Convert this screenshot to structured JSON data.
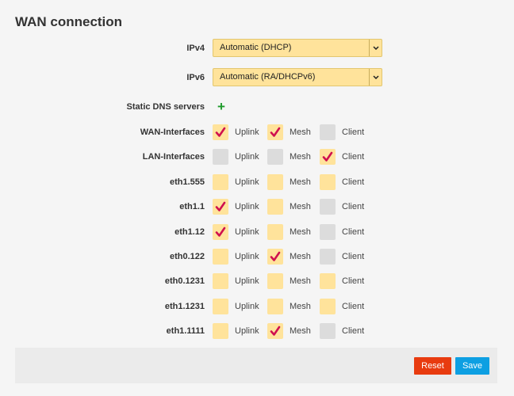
{
  "page_title": "WAN connection",
  "ipv4": {
    "label": "IPv4",
    "value": "Automatic (DHCP)"
  },
  "ipv6": {
    "label": "IPv6",
    "value": "Automatic (RA/DHCPv6)"
  },
  "static_dns": {
    "label": "Static DNS servers",
    "add_symbol": "+"
  },
  "columns": [
    "Uplink",
    "Mesh",
    "Client"
  ],
  "interfaces": [
    {
      "name": "WAN-Interfaces",
      "uplink": true,
      "mesh": true,
      "client": false,
      "colors": [
        "yellow",
        "yellow",
        "grey"
      ]
    },
    {
      "name": "LAN-Interfaces",
      "uplink": false,
      "mesh": false,
      "client": true,
      "colors": [
        "grey",
        "grey",
        "yellow"
      ]
    },
    {
      "name": "eth1.555",
      "uplink": false,
      "mesh": false,
      "client": false,
      "colors": [
        "yellow",
        "yellow",
        "yellow"
      ]
    },
    {
      "name": "eth1.1",
      "uplink": true,
      "mesh": false,
      "client": false,
      "colors": [
        "yellow",
        "yellow",
        "grey"
      ]
    },
    {
      "name": "eth1.12",
      "uplink": true,
      "mesh": false,
      "client": false,
      "colors": [
        "yellow",
        "yellow",
        "grey"
      ]
    },
    {
      "name": "eth0.122",
      "uplink": false,
      "mesh": true,
      "client": false,
      "colors": [
        "yellow",
        "yellow",
        "grey"
      ]
    },
    {
      "name": "eth0.1231",
      "uplink": false,
      "mesh": false,
      "client": false,
      "colors": [
        "yellow",
        "yellow",
        "yellow"
      ]
    },
    {
      "name": "eth1.1231",
      "uplink": false,
      "mesh": false,
      "client": false,
      "colors": [
        "yellow",
        "yellow",
        "yellow"
      ]
    },
    {
      "name": "eth1.1111",
      "uplink": false,
      "mesh": true,
      "client": false,
      "colors": [
        "yellow",
        "yellow",
        "grey"
      ]
    }
  ],
  "buttons": {
    "reset": "Reset",
    "save": "Save"
  },
  "colors": {
    "field_yellow": "#ffe39b",
    "field_grey": "#dcdcdc",
    "check": "#d0114f",
    "add_green": "#1d9a2a",
    "reset_bg": "#e83b0f",
    "save_bg": "#0d9fe2"
  }
}
